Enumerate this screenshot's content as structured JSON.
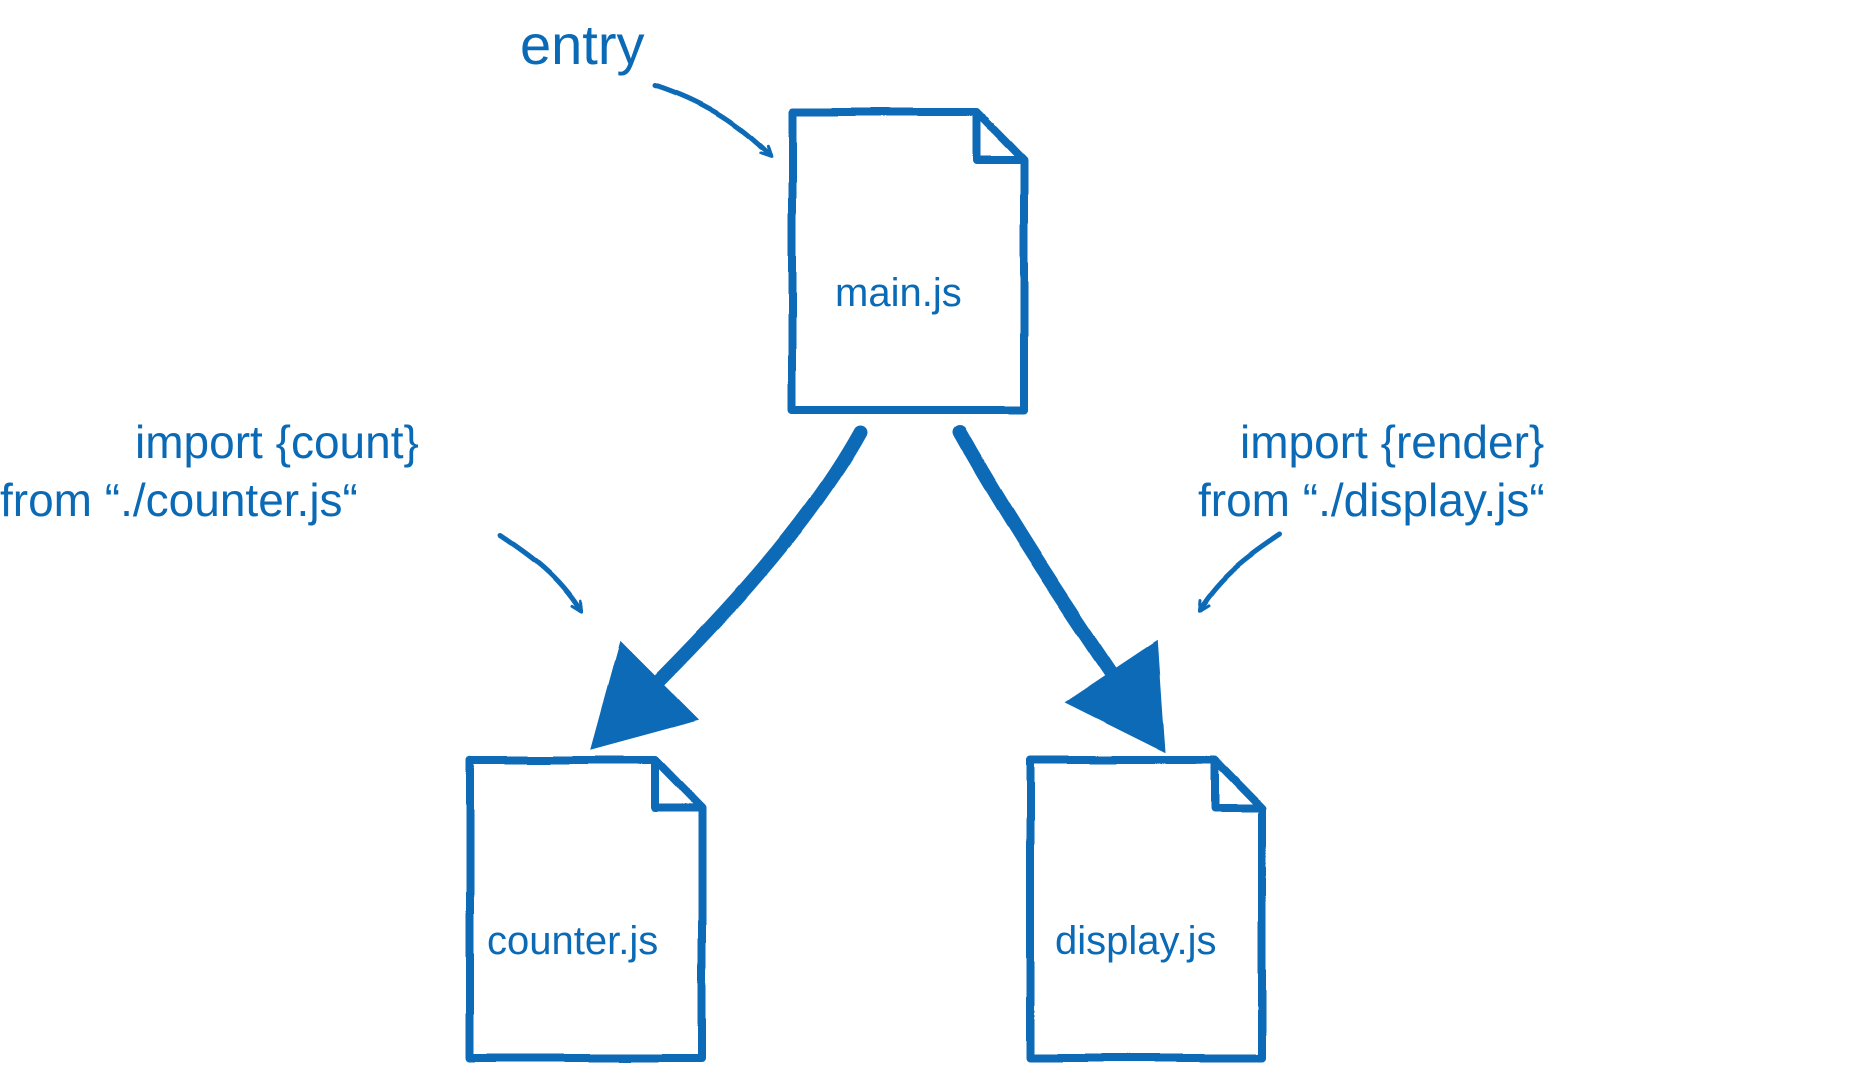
{
  "diagram": {
    "entry_label": "entry",
    "files": {
      "main": "main.js",
      "counter": "counter.js",
      "display": "display.js"
    },
    "imports": {
      "left": {
        "line1": "import {count}",
        "line2": "from “./counter.js“"
      },
      "right": {
        "line1": "import {render}",
        "line2": "from “./display.js“"
      }
    },
    "color": "#0a6ab6"
  }
}
